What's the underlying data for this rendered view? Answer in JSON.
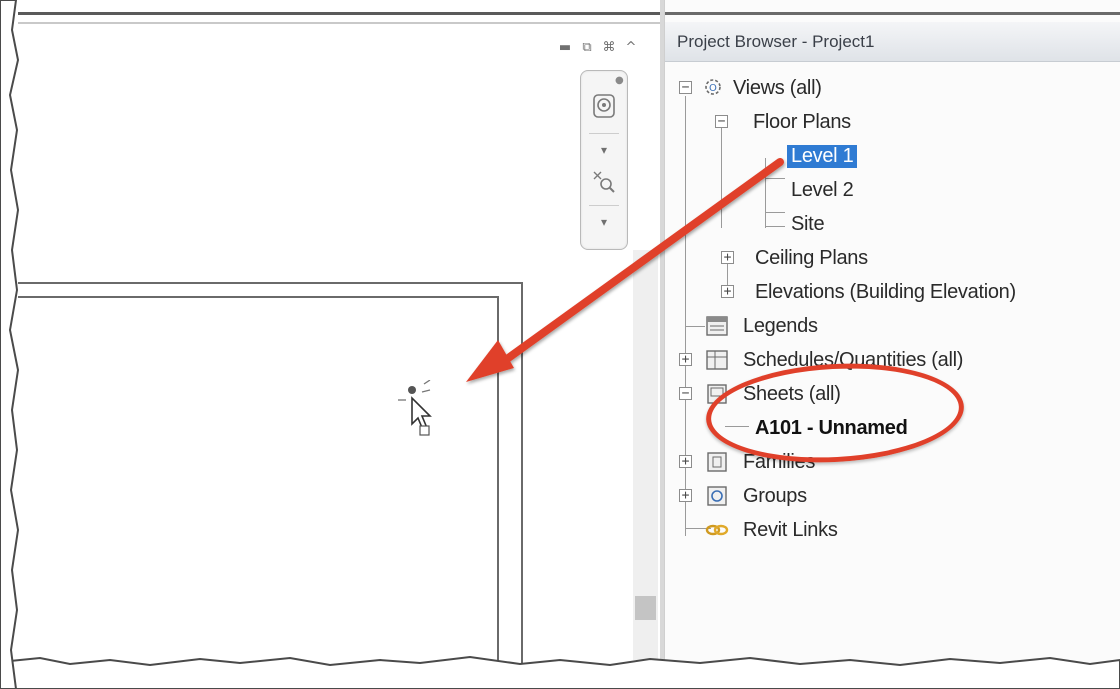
{
  "view_window": {
    "controls": {
      "minimize_label": "▬",
      "restore_label": "⧉",
      "close_label": "⌘",
      "collapse_label": "^"
    }
  },
  "project_browser": {
    "title": "Project Browser - Project1",
    "tree": {
      "views": "Views (all)",
      "floor_plans": "Floor Plans",
      "level1": "Level 1",
      "level2": "Level 2",
      "site": "Site",
      "ceiling_plans": "Ceiling Plans",
      "elevations": "Elevations (Building Elevation)",
      "legends": "Legends",
      "schedules": "Schedules/Quantities (all)",
      "sheets": "Sheets (all)",
      "sheet_a101": "A101 - Unnamed",
      "families": "Families",
      "groups": "Groups",
      "revit_links": "Revit Links"
    },
    "toggles": {
      "expanded": "−",
      "collapsed": "+"
    }
  },
  "colors": {
    "annotation_red": "#e0402a",
    "selection_blue": "#2f7bd3"
  }
}
